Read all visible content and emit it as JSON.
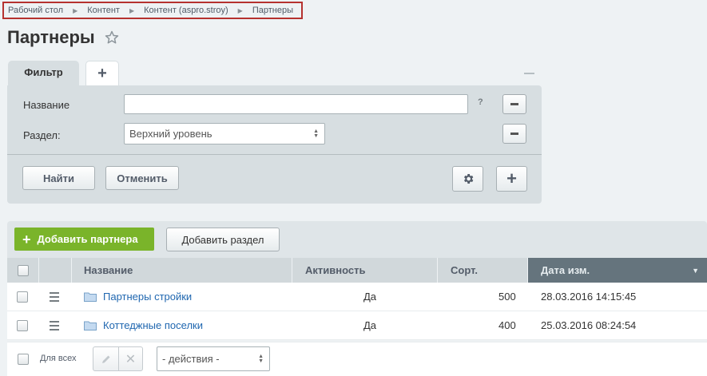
{
  "breadcrumb": {
    "items": [
      "Рабочий стол",
      "Контент",
      "Контент (aspro.stroy)",
      "Партнеры"
    ],
    "separator": "▶"
  },
  "page": {
    "title": "Партнеры"
  },
  "filter": {
    "tab_label": "Фильтр",
    "add_tab_label": "+",
    "fields": [
      {
        "label": "Название",
        "value": "",
        "help": "?"
      },
      {
        "label": "Раздел:",
        "value": "Верхний уровень"
      }
    ],
    "find_label": "Найти",
    "cancel_label": "Отменить",
    "plus_label": "+"
  },
  "toolbar": {
    "add_partner_label": "Добавить партнера",
    "add_section_label": "Добавить раздел",
    "add_color": "#7ab42a"
  },
  "table": {
    "columns": [
      "Название",
      "Активность",
      "Сорт.",
      "Дата изм."
    ],
    "sorted_column": "Дата изм.",
    "rows": [
      {
        "name": "Партнеры стройки",
        "active": "Да",
        "sort": "500",
        "date": "28.03.2016 14:15:45"
      },
      {
        "name": "Коттеджные поселки",
        "active": "Да",
        "sort": "400",
        "date": "25.03.2016 08:24:54"
      }
    ]
  },
  "footer": {
    "for_all_label": "Для всех",
    "actions_value": "- действия -"
  }
}
